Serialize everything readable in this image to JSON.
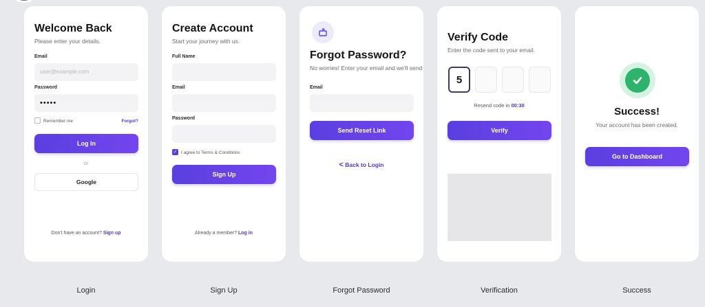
{
  "colors": {
    "accent": "#5a3fe0",
    "success": "#2db36b",
    "background": "#e8e9ed"
  },
  "login": {
    "title": "Welcome Back",
    "subtitle": "Please enter your details.",
    "email_label": "Email",
    "email_placeholder": "user@example.com",
    "password_label": "Password",
    "password_value": "•••••",
    "remember_label": "Remember me",
    "forgot_link": "Forgot?",
    "login_button": "Log In",
    "or_text": "Or",
    "google_button": "Google",
    "footer_text": "Don't have an account?",
    "footer_link": "Sign up",
    "caption": "Login"
  },
  "signup": {
    "title": "Create Account",
    "subtitle": "Start your journey with us.",
    "fullname_label": "Full Name",
    "email_label": "Email",
    "password_label": "Password",
    "terms_label": "I agree to Terms & Conditions",
    "signup_button": "Sign Up",
    "footer_text": "Already a member?",
    "footer_link": "Log in",
    "caption": "Sign Up"
  },
  "forgot": {
    "icon": "mailbox-icon",
    "title": "Forgot Password?",
    "subtitle": "No worries! Enter your email and we'll send you",
    "email_label": "Email",
    "send_button": "Send Reset Link",
    "back_link": "Back to Login",
    "caption": "Forgot Password"
  },
  "verify": {
    "title": "Verify Code",
    "subtitle": "Enter the code sent to your email.",
    "digits": [
      "5",
      "",
      "",
      ""
    ],
    "resend_text": "Resend code in",
    "resend_timer": "00:30",
    "verify_button": "Verify",
    "caption": "Verification"
  },
  "success": {
    "icon": "checkmark-icon",
    "title": "Success!",
    "subtitle": "Your account has been created.",
    "dashboard_button": "Go to Dashboard",
    "caption": "Success"
  }
}
